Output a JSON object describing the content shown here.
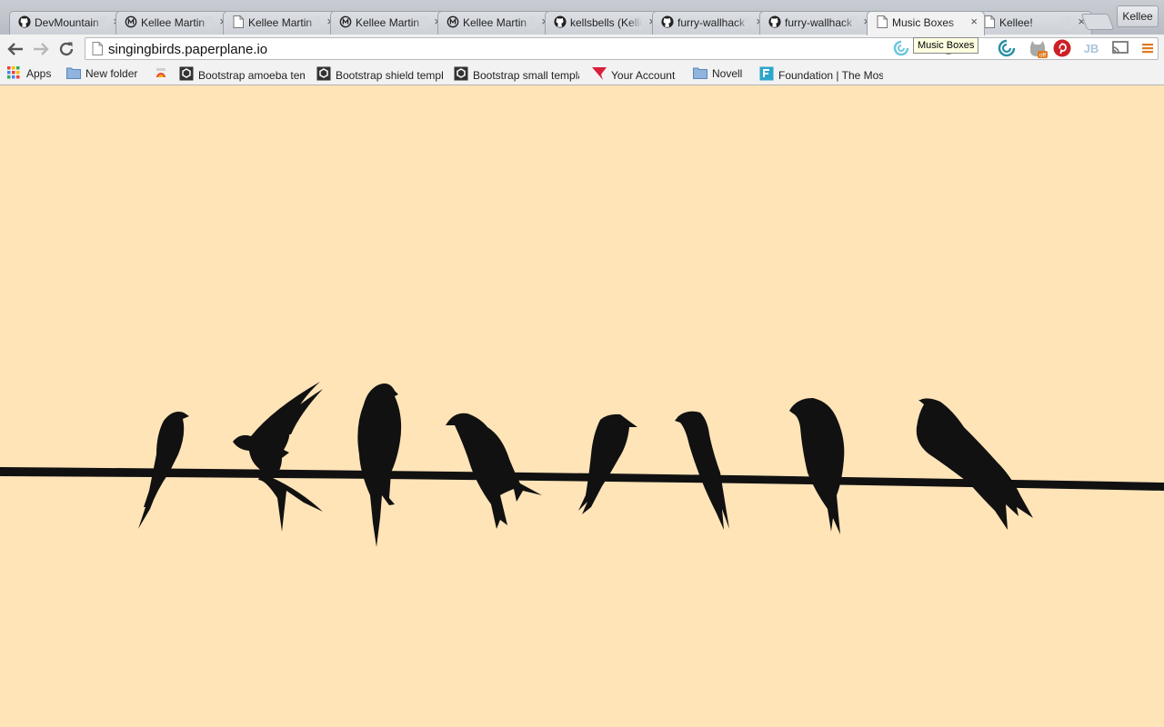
{
  "browser": {
    "tabs": [
      {
        "title": "DevMountain",
        "icon": "github-icon",
        "active": false
      },
      {
        "title": "Kellee Martin",
        "icon": "meetup-icon",
        "active": false
      },
      {
        "title": "Kellee Martin",
        "icon": "page-icon",
        "active": false
      },
      {
        "title": "Kellee Martin",
        "icon": "meetup-icon",
        "active": false
      },
      {
        "title": "Kellee Martin",
        "icon": "meetup-icon",
        "active": false
      },
      {
        "title": "kellsbells (Kellee)",
        "icon": "github-icon",
        "active": false
      },
      {
        "title": "furry-wallhack",
        "icon": "github-icon",
        "active": false
      },
      {
        "title": "furry-wallhack",
        "icon": "github-icon",
        "active": false
      },
      {
        "title": "Music Boxes",
        "icon": "page-icon",
        "active": true
      },
      {
        "title": "Kellee!",
        "icon": "page-icon",
        "active": false
      }
    ],
    "tab_close_glyph": "×",
    "profile_name": "Kellee",
    "url": "singingbirds.paperplane.io",
    "tooltip": "Music Boxes",
    "extensions": [
      "swirl-icon",
      "puzzle-icon",
      "circle-icon",
      "swirl-teal-icon",
      "cat-off-icon",
      "pinterest-icon",
      "jb-icon",
      "cast-icon",
      "menu-icon"
    ],
    "ext_badge": "off",
    "ext_jb_label": "JB"
  },
  "bookmarks": [
    {
      "label": "Apps",
      "icon": "apps-grid-icon"
    },
    {
      "label": "New folder",
      "icon": "folder-icon"
    },
    {
      "label": "",
      "icon": "color-icon"
    },
    {
      "label": "Bootstrap amoeba template",
      "icon": "hex-icon"
    },
    {
      "label": "Bootstrap shield template",
      "icon": "hex-icon"
    },
    {
      "label": "Bootstrap small template",
      "icon": "hex-icon"
    },
    {
      "label": "Your Account",
      "icon": "red-flag-icon"
    },
    {
      "label": "Novell",
      "icon": "folder-icon"
    },
    {
      "label": "Foundation | The Most Advanced",
      "icon": "foundation-icon"
    }
  ],
  "page": {
    "background": "#ffe4b8",
    "silhouette_color": "#111111",
    "birds": [
      "bird-1",
      "bird-2",
      "bird-3",
      "bird-4",
      "bird-5",
      "bird-6",
      "bird-7",
      "bird-8"
    ]
  }
}
